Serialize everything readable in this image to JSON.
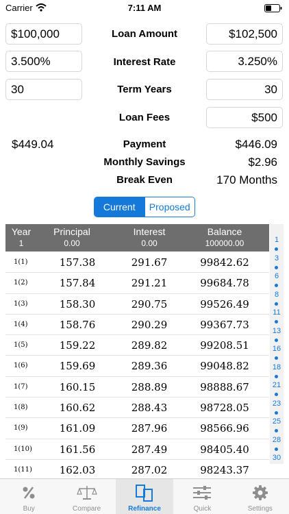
{
  "status": {
    "carrier": "Carrier",
    "time": "7:11 AM"
  },
  "form": {
    "loan_amount": {
      "label": "Loan Amount",
      "current": "$100,000",
      "proposed": "$102,500"
    },
    "interest_rate": {
      "label": "Interest Rate",
      "current": "3.500%",
      "proposed": "3.250%"
    },
    "term_years": {
      "label": "Term Years",
      "current": "30",
      "proposed": "30"
    },
    "loan_fees": {
      "label": "Loan Fees",
      "proposed": "$500"
    }
  },
  "summary": {
    "payment": {
      "label": "Payment",
      "current": "$449.04",
      "proposed": "$446.09"
    },
    "monthly_savings": {
      "label": "Monthly Savings",
      "value": "$2.96"
    },
    "break_even": {
      "label": "Break Even",
      "value": "170 Months"
    }
  },
  "segment": {
    "current": "Current",
    "proposed": "Proposed",
    "selected": "Current"
  },
  "table": {
    "header": {
      "year": "Year",
      "principal": "Principal",
      "interest": "Interest",
      "balance": "Balance"
    },
    "header_values": {
      "year": "1",
      "principal": "0.00",
      "interest": "0.00",
      "balance": "100000.00"
    },
    "rows": [
      {
        "year": "1(1)",
        "principal": "157.38",
        "interest": "291.67",
        "balance": "99842.62"
      },
      {
        "year": "1(2)",
        "principal": "157.84",
        "interest": "291.21",
        "balance": "99684.78"
      },
      {
        "year": "1(3)",
        "principal": "158.30",
        "interest": "290.75",
        "balance": "99526.49"
      },
      {
        "year": "1(4)",
        "principal": "158.76",
        "interest": "290.29",
        "balance": "99367.73"
      },
      {
        "year": "1(5)",
        "principal": "159.22",
        "interest": "289.82",
        "balance": "99208.51"
      },
      {
        "year": "1(6)",
        "principal": "159.69",
        "interest": "289.36",
        "balance": "99048.82"
      },
      {
        "year": "1(7)",
        "principal": "160.15",
        "interest": "288.89",
        "balance": "98888.67"
      },
      {
        "year": "1(8)",
        "principal": "160.62",
        "interest": "288.43",
        "balance": "98728.05"
      },
      {
        "year": "1(9)",
        "principal": "161.09",
        "interest": "287.96",
        "balance": "98566.96"
      },
      {
        "year": "1(10)",
        "principal": "161.56",
        "interest": "287.49",
        "balance": "98405.40"
      },
      {
        "year": "1(11)",
        "principal": "162.03",
        "interest": "287.02",
        "balance": "98243.37"
      }
    ]
  },
  "index_bar": [
    "1",
    "3",
    "6",
    "8",
    "11",
    "13",
    "16",
    "18",
    "21",
    "23",
    "25",
    "28",
    "30"
  ],
  "tabs": [
    {
      "label": "Buy",
      "icon": "percent-icon"
    },
    {
      "label": "Compare",
      "icon": "scale-icon"
    },
    {
      "label": "Refinance",
      "icon": "documents-icon",
      "active": true
    },
    {
      "label": "Quick",
      "icon": "sliders-icon"
    },
    {
      "label": "Settings",
      "icon": "gear-icon"
    }
  ],
  "colors": {
    "accent": "#1479d8",
    "header_bg": "#6e6e6e"
  }
}
